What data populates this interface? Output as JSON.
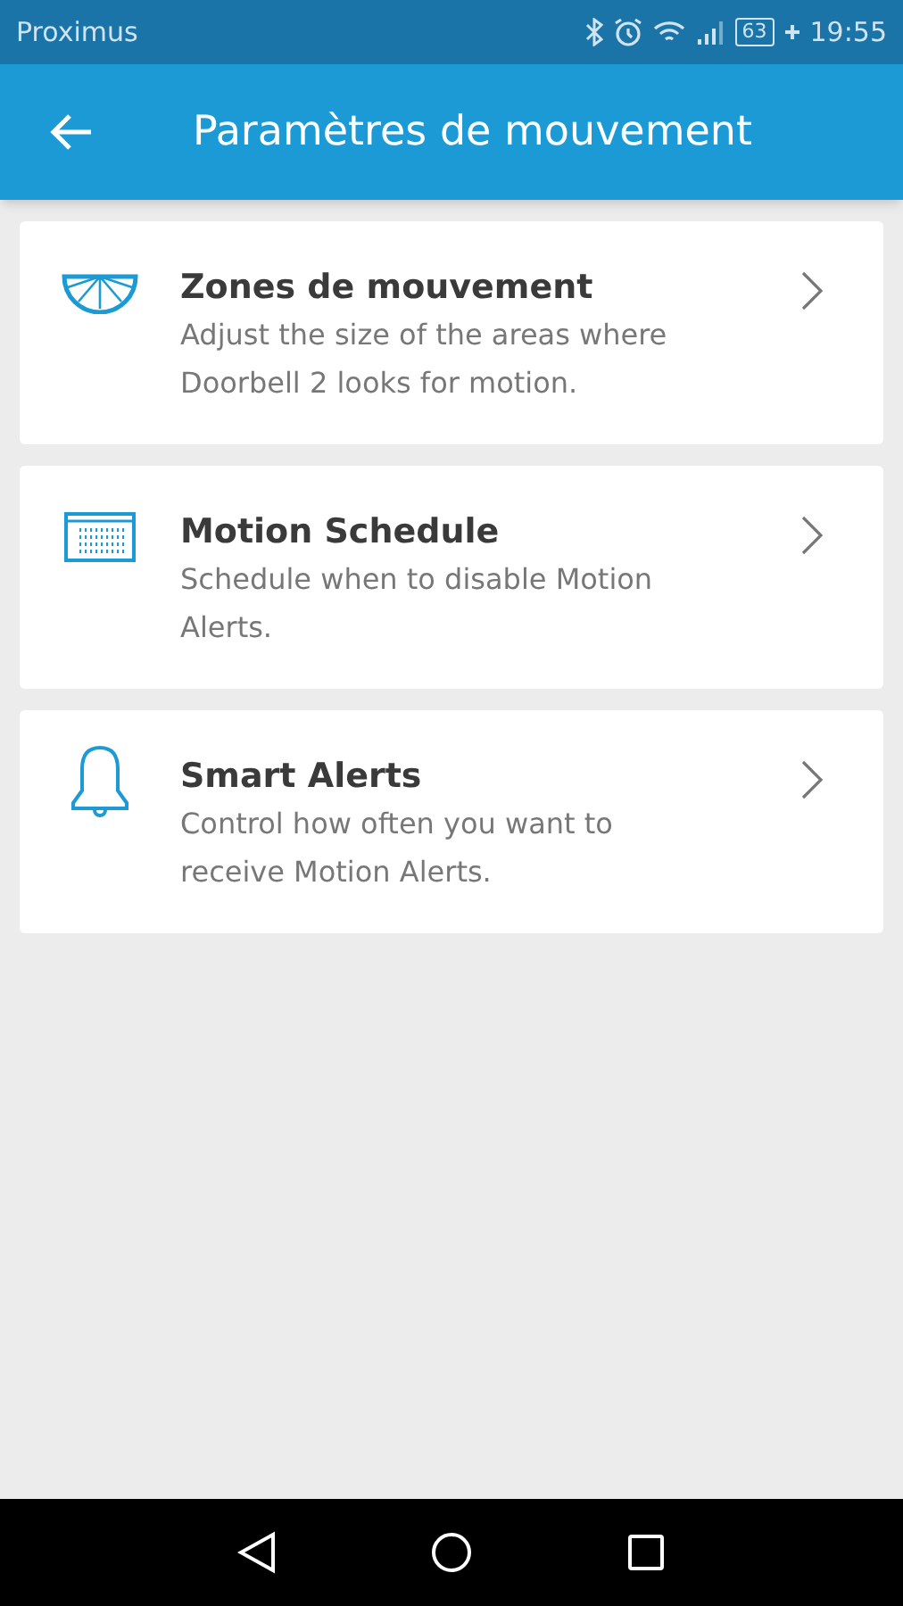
{
  "status_bar": {
    "carrier": "Proximus",
    "battery": "63",
    "time": "19:55"
  },
  "app_bar": {
    "title": "Paramètres de mouvement"
  },
  "items": [
    {
      "kind": "zones",
      "title": "Zones de mouvement",
      "description": "Adjust the size of the areas where Doorbell 2 looks for motion."
    },
    {
      "kind": "calendar",
      "title": "Motion Schedule",
      "description": "Schedule when to disable Motion Alerts."
    },
    {
      "kind": "bell",
      "title": "Smart Alerts",
      "description": "Control how often you want to receive Motion Alerts."
    }
  ]
}
